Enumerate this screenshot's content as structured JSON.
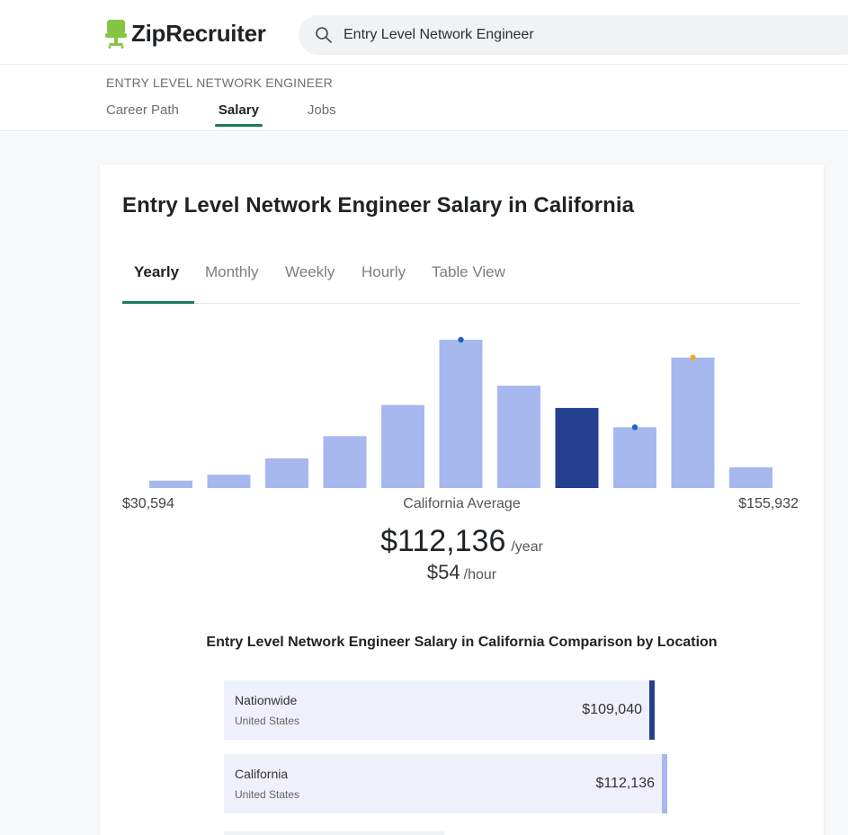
{
  "header": {
    "brand": "ZipRecruiter",
    "search_value": "Entry Level Network Engineer",
    "brand_color": "#86c543"
  },
  "subnav": {
    "title": "ENTRY LEVEL NETWORK ENGINEER",
    "tabs": [
      {
        "label": "Career Path",
        "active": false
      },
      {
        "label": "Salary",
        "active": true
      },
      {
        "label": "Jobs",
        "active": false
      }
    ]
  },
  "card": {
    "title": "Entry Level Network Engineer Salary in California",
    "period_tabs": [
      {
        "label": "Yearly",
        "active": true
      },
      {
        "label": "Monthly",
        "active": false
      },
      {
        "label": "Weekly",
        "active": false
      },
      {
        "label": "Hourly",
        "active": false
      },
      {
        "label": "Table View",
        "active": false
      }
    ],
    "range_min": "$30,594",
    "range_max": "$155,932",
    "average_label": "California Average",
    "average_yearly": "$112,136",
    "yearly_unit": "/year",
    "average_hourly": "$54",
    "hourly_unit": "/hour",
    "comparison_title": "Entry Level Network Engineer Salary in California Comparison by Location",
    "locations": [
      {
        "name": "Nationwide",
        "sub": "United States",
        "value": "$109,040",
        "marker_color": "#24408e",
        "fraction": 0.972
      },
      {
        "name": "California",
        "sub": "United States",
        "value": "$112,136",
        "marker_color": "#a7b8ef",
        "fraction": 1.0
      }
    ]
  },
  "chart_data": {
    "type": "bar",
    "bar_heights_relative": [
      0.05,
      0.09,
      0.2,
      0.35,
      0.56,
      1.0,
      0.69,
      0.54,
      0.41,
      0.88,
      0.14
    ],
    "highlight_index": 7,
    "dot_markers": [
      {
        "index": 5,
        "color": "#1a66c7"
      },
      {
        "index": 8,
        "color": "#1a66c7"
      },
      {
        "index": 9,
        "color": "#f5a623"
      }
    ],
    "bar_color": "#a7b8ef",
    "highlight_color": "#24408e"
  }
}
